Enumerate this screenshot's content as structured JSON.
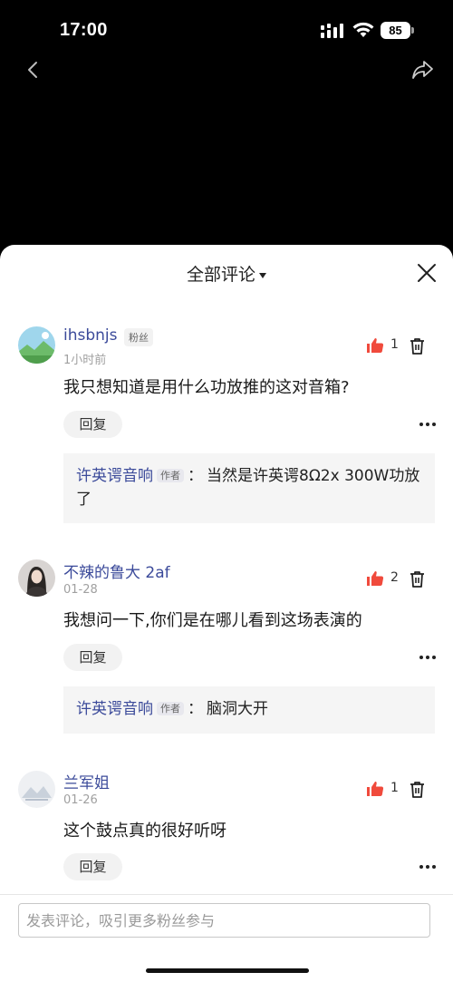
{
  "status": {
    "time": "17:00",
    "battery": "85"
  },
  "sheet": {
    "title": "全部评论"
  },
  "comments": [
    {
      "username": "ihsbnjs",
      "badge": "粉丝",
      "time": "1小时前",
      "text": "我只想知道是用什么功放推的这对音箱?",
      "likes": "1",
      "reply_label": "回复",
      "reply": {
        "author": "许英谔音响",
        "author_badge": "作者",
        "sep": "：",
        "text": "当然是许英谔8Ω2x 300W功放了"
      }
    },
    {
      "username": "不辣的鲁大 2af",
      "time": "01-28",
      "text": "我想问一下,你们是在哪儿看到这场表演的",
      "likes": "2",
      "reply_label": "回复",
      "reply": {
        "author": "许英谔音响",
        "author_badge": "作者",
        "sep": "：",
        "text": "脑洞大开"
      }
    },
    {
      "username": "兰军姐",
      "time": "01-26",
      "text": "这个鼓点真的很好听呀",
      "likes": "1",
      "reply_label": "回复"
    }
  ],
  "input": {
    "placeholder": "发表评论，吸引更多粉丝参与"
  },
  "colors": {
    "username": "#3b4a9a",
    "like": "#f04a3c"
  }
}
